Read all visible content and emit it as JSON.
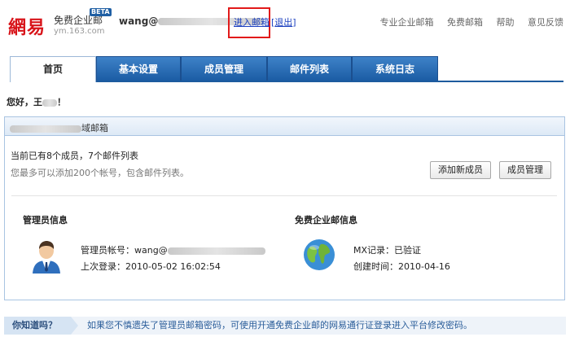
{
  "header": {
    "logo_main": "網易",
    "logo_line1": "免费企业邮",
    "logo_line2": "ym.163.com",
    "beta": "BETA",
    "user_prefix": "wang@",
    "enter_mailbox": "进入邮箱",
    "logout": "退出",
    "links": [
      "专业企业邮箱",
      "免费邮箱",
      "帮助",
      "意见反馈"
    ]
  },
  "tabs": [
    "首页",
    "基本设置",
    "成员管理",
    "邮件列表",
    "系统日志"
  ],
  "greeting": {
    "prefix": "您好，王",
    "suffix": "！"
  },
  "mailbox": {
    "title_suffix": "域邮箱",
    "count_text": "当前已有8个成员，7个邮件列表",
    "hint_text": "您最多可以添加200个帐号，包含邮件列表。",
    "add_member_button": "添加新成员",
    "member_manage_button": "成员管理"
  },
  "admin": {
    "title": "管理员信息",
    "account_label": "管理员帐号：wang@",
    "last_login": "上次登录：2010-05-02 16:02:54"
  },
  "enterprise": {
    "title": "免费企业邮信息",
    "mx": "MX记录：已验证",
    "created": "创建时间：2010-04-16"
  },
  "tip": {
    "label": "你知道吗？",
    "text": "如果您不慎遗失了管理员邮箱密码，可使用开通免费企业邮的网易通行证登录进入平台修改密码。"
  }
}
